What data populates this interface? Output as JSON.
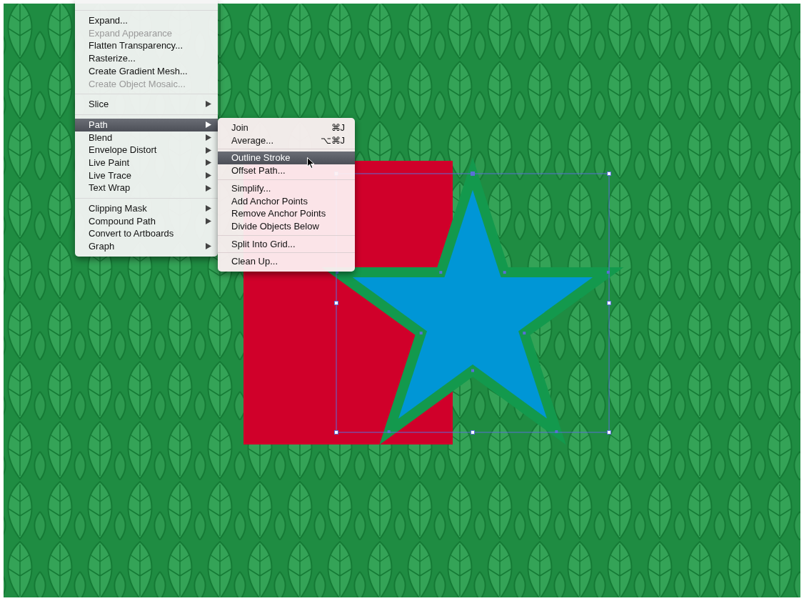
{
  "object_menu": {
    "groups": [
      {
        "items": [
          {
            "label": "Expand...",
            "disabled": false,
            "submenu": false,
            "selected": false
          },
          {
            "label": "Expand Appearance",
            "disabled": true,
            "submenu": false,
            "selected": false
          },
          {
            "label": "Flatten Transparency...",
            "disabled": false,
            "submenu": false,
            "selected": false
          },
          {
            "label": "Rasterize...",
            "disabled": false,
            "submenu": false,
            "selected": false
          },
          {
            "label": "Create Gradient Mesh...",
            "disabled": false,
            "submenu": false,
            "selected": false
          },
          {
            "label": "Create Object Mosaic...",
            "disabled": true,
            "submenu": false,
            "selected": false
          }
        ]
      },
      {
        "items": [
          {
            "label": "Slice",
            "disabled": false,
            "submenu": true,
            "selected": false
          }
        ]
      },
      {
        "items": [
          {
            "label": "Path",
            "disabled": false,
            "submenu": true,
            "selected": true
          },
          {
            "label": "Blend",
            "disabled": false,
            "submenu": true,
            "selected": false
          },
          {
            "label": "Envelope Distort",
            "disabled": false,
            "submenu": true,
            "selected": false
          },
          {
            "label": "Live Paint",
            "disabled": false,
            "submenu": true,
            "selected": false
          },
          {
            "label": "Live Trace",
            "disabled": false,
            "submenu": true,
            "selected": false
          },
          {
            "label": "Text Wrap",
            "disabled": false,
            "submenu": true,
            "selected": false
          }
        ]
      },
      {
        "items": [
          {
            "label": "Clipping Mask",
            "disabled": false,
            "submenu": true,
            "selected": false
          },
          {
            "label": "Compound Path",
            "disabled": false,
            "submenu": true,
            "selected": false
          },
          {
            "label": "Convert to Artboards",
            "disabled": false,
            "submenu": false,
            "selected": false
          },
          {
            "label": "Graph",
            "disabled": false,
            "submenu": true,
            "selected": false
          }
        ]
      }
    ]
  },
  "path_submenu": {
    "groups": [
      {
        "items": [
          {
            "label": "Join",
            "shortcut": "⌘J",
            "selected": false
          },
          {
            "label": "Average...",
            "shortcut": "⌥⌘J",
            "selected": false
          }
        ]
      },
      {
        "items": [
          {
            "label": "Outline Stroke",
            "selected": true
          },
          {
            "label": "Offset Path...",
            "selected": false
          }
        ]
      },
      {
        "items": [
          {
            "label": "Simplify...",
            "selected": false
          },
          {
            "label": "Add Anchor Points",
            "selected": false
          },
          {
            "label": "Remove Anchor Points",
            "selected": false
          },
          {
            "label": "Divide Objects Below",
            "selected": false
          }
        ]
      },
      {
        "items": [
          {
            "label": "Split Into Grid...",
            "selected": false
          }
        ]
      },
      {
        "items": [
          {
            "label": "Clean Up...",
            "selected": false
          }
        ]
      }
    ]
  }
}
